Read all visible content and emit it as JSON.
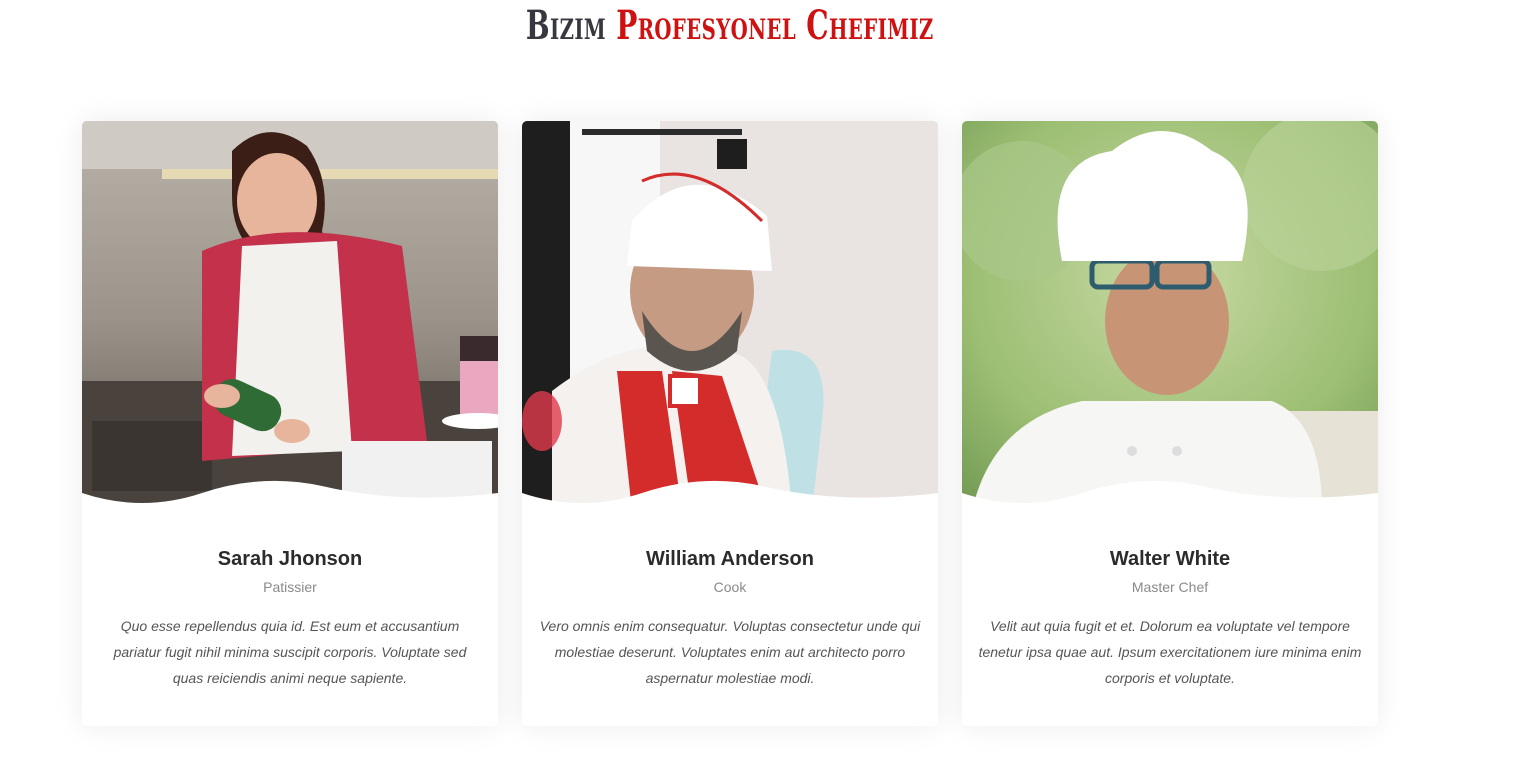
{
  "section": {
    "title_part1": "Bizim ",
    "title_part2": "Profesyonel Chefimiz",
    "title_color": "#37373f",
    "accent_color": "#ce1212"
  },
  "chefs": [
    {
      "name": "Sarah Jhonson",
      "role": "Patissier",
      "description": "Quo esse repellendus quia id. Est eum et accusantium pariatur fugit nihil minima suscipit corporis. Voluptate sed quas reiciendis animi neque sapiente."
    },
    {
      "name": "William Anderson",
      "role": "Cook",
      "description": "Vero omnis enim consequatur. Voluptas consectetur unde qui molestiae deserunt. Voluptates enim aut architecto porro aspernatur molestiae modi."
    },
    {
      "name": "Walter White",
      "role": "Master Chef",
      "description": "Velit aut quia fugit et et. Dolorum ea voluptate vel tempore tenetur ipsa quae aut. Ipsum exercitationem iure minima enim corporis et voluptate."
    }
  ]
}
